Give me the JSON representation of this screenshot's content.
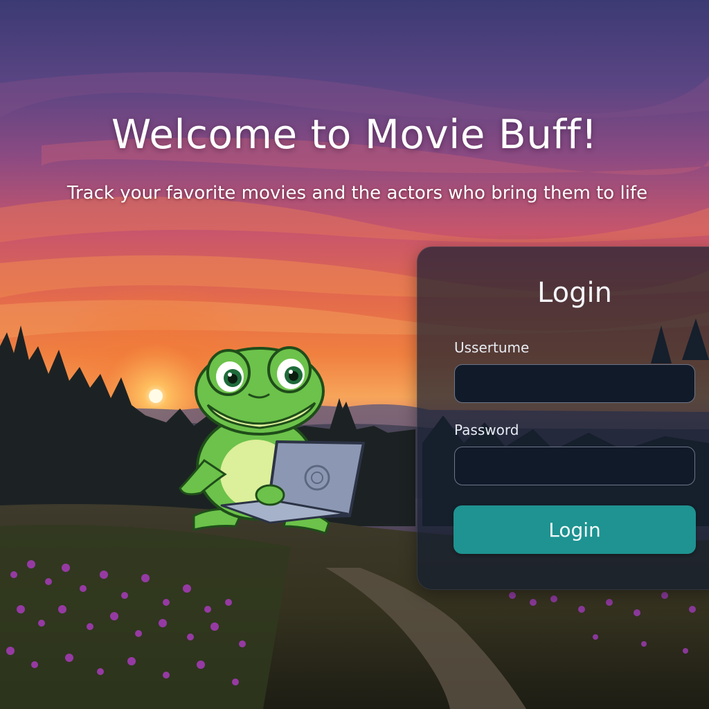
{
  "hero": {
    "title": "Welcome to Movie Buff!",
    "subtitle": "Track your favorite movies and the actors who bring them to life"
  },
  "login": {
    "title": "Login",
    "username_label": "Ussertume",
    "username_value": "",
    "password_label": "Password",
    "password_value": "",
    "button_label": "Login"
  },
  "colors": {
    "accent": "#1e9391",
    "panel": "#141e30",
    "input_bg": "#111a29"
  },
  "icons": {
    "mascot": "frog-with-laptop"
  }
}
